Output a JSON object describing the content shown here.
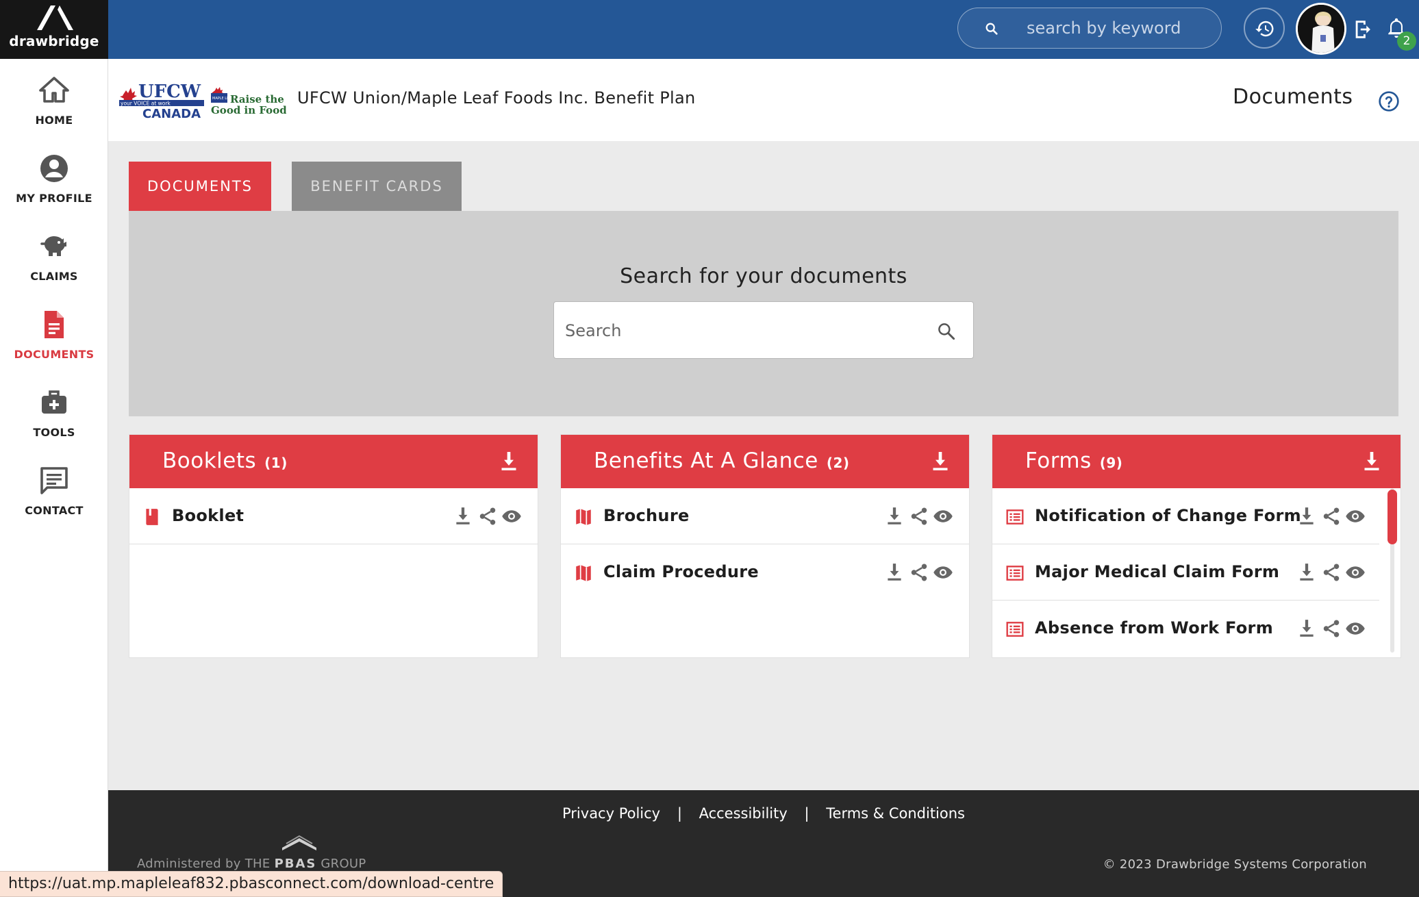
{
  "app": {
    "brand": "drawbridge",
    "keyword_search_placeholder": "search by keyword",
    "notification_count": "2"
  },
  "sidebar": {
    "items": [
      {
        "label": "HOME",
        "icon": "home-icon"
      },
      {
        "label": "MY PROFILE",
        "icon": "user-circle-icon"
      },
      {
        "label": "CLAIMS",
        "icon": "piggy-bank-icon"
      },
      {
        "label": "DOCUMENTS",
        "icon": "document-icon",
        "active": true
      },
      {
        "label": "TOOLS",
        "icon": "medical-kit-icon"
      },
      {
        "label": "CONTACT",
        "icon": "message-icon"
      }
    ]
  },
  "header": {
    "plan_logo_text": [
      "UFCW",
      "your VOICE at work",
      "CANADA",
      "Raise the",
      "Good in Food",
      "MAPLE LEAF"
    ],
    "plan_title": "UFCW Union/Maple Leaf Foods Inc. Benefit Plan",
    "page_title": "Documents"
  },
  "tabs": [
    {
      "label": "DOCUMENTS",
      "active": true
    },
    {
      "label": "BENEFIT CARDS",
      "active": false
    }
  ],
  "search_panel": {
    "heading": "Search for your documents",
    "placeholder": "Search"
  },
  "cards": [
    {
      "title": "Booklets",
      "count": "(1)",
      "item_icon": "book-icon",
      "items": [
        "Booklet"
      ]
    },
    {
      "title": "Benefits At A Glance",
      "count": "(2)",
      "item_icon": "map-icon",
      "items": [
        "Brochure",
        "Claim Procedure"
      ]
    },
    {
      "title": "Forms",
      "count": "(9)",
      "item_icon": "list-icon",
      "items": [
        "Notification of Change Form",
        "Major Medical Claim Form",
        "Absence from Work Form"
      ]
    }
  ],
  "footer": {
    "links": [
      "Privacy Policy",
      "Accessibility",
      "Terms & Conditions"
    ],
    "separator": "|",
    "admin_prefix": "Administered by",
    "admin_the": "THE",
    "admin_brand": "PBAS",
    "admin_group": "GROUP",
    "copyright": "© 2023 Drawbridge Systems Corporation"
  },
  "status_bar": {
    "url": "https://uat.mp.mapleleaf832.pbasconnect.com/download-centre"
  },
  "colors": {
    "topbar": "#245796",
    "accent_red": "#df3d44",
    "tab_inactive": "#8b8b8b",
    "footer": "#292929",
    "badge_green": "#3fa24c"
  }
}
